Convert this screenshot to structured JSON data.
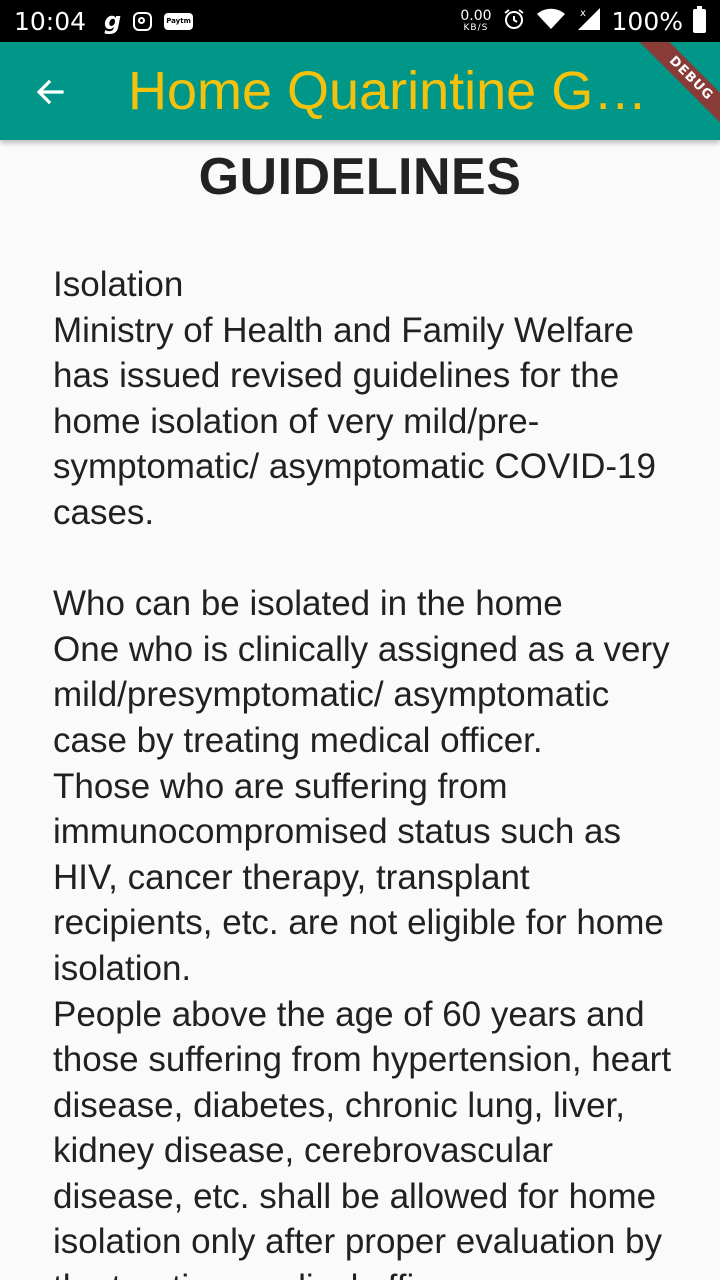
{
  "status_bar": {
    "time": "10:04",
    "speed_value": "0.00",
    "speed_unit": "KB/S",
    "battery": "100%",
    "paytm_label": "Paytm"
  },
  "app_bar": {
    "title": "Home Quarintine Guidelines",
    "debug_label": "DEBUG"
  },
  "heading": "GUIDELINES",
  "body_text": "Isolation\nMinistry of Health and Family Welfare has issued revised guidelines for the home isolation of very mild/pre-symptomatic/ asymptomatic COVID-19 cases.\n\nWho can be isolated in the home\nOne who is clinically assigned as a very mild/presymptomatic/ asymptomatic case by treating medical officer.\nThose who are suffering from immunocompromised status such as HIV, cancer therapy, transplant recipients, etc. are not eligible for home isolation.\nPeople above the age of 60 years and those suffering from hypertension, heart disease, diabetes, chronic lung, liver, kidney disease, cerebrovascular disease, etc. shall be allowed for home isolation only after proper evaluation by the treating medical officer."
}
